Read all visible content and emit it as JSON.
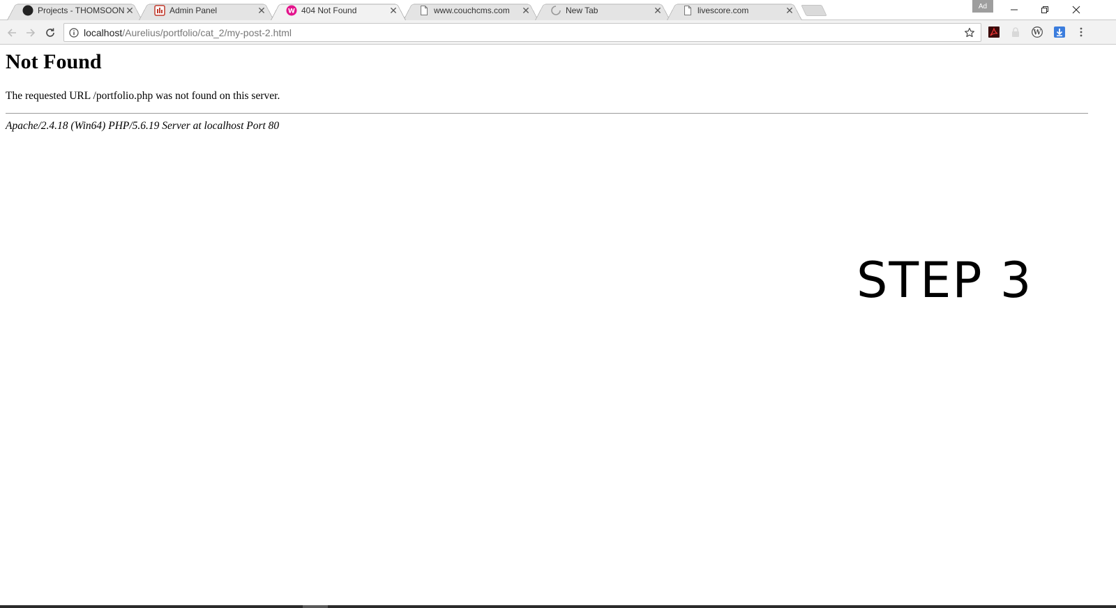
{
  "browser": {
    "tabs": [
      {
        "title": "Projects - THOMSOON -",
        "favicon": "github-icon",
        "active": false
      },
      {
        "title": "Admin Panel",
        "favicon": "admin-panel-icon",
        "active": false
      },
      {
        "title": "404 Not Found",
        "favicon": "wamp-icon",
        "active": true
      },
      {
        "title": "www.couchcms.com",
        "favicon": "page-icon",
        "active": false
      },
      {
        "title": "New Tab",
        "favicon": "loading-spinner-icon",
        "active": false
      },
      {
        "title": "livescore.com",
        "favicon": "page-icon",
        "active": false
      }
    ],
    "ad_badge": "Ad",
    "address_bar": {
      "host": "localhost",
      "path": "/Aurelius/portfolio/cat_2/my-post-2.html"
    },
    "extensions": [
      "acrobat-icon",
      "lock-extension-icon",
      "wordpress-icon",
      "download-icon"
    ],
    "colors": {
      "wamp_pink": "#e3148c",
      "acrobat_red": "#b40e0e",
      "download_blue": "#3b7ddd"
    }
  },
  "page": {
    "heading": "Not Found",
    "message": "The requested URL /portfolio.php was not found on this server.",
    "server_signature": "Apache/2.4.18 (Win64) PHP/5.6.19 Server at localhost Port 80"
  },
  "overlay": {
    "step_label": "STEP 3"
  }
}
